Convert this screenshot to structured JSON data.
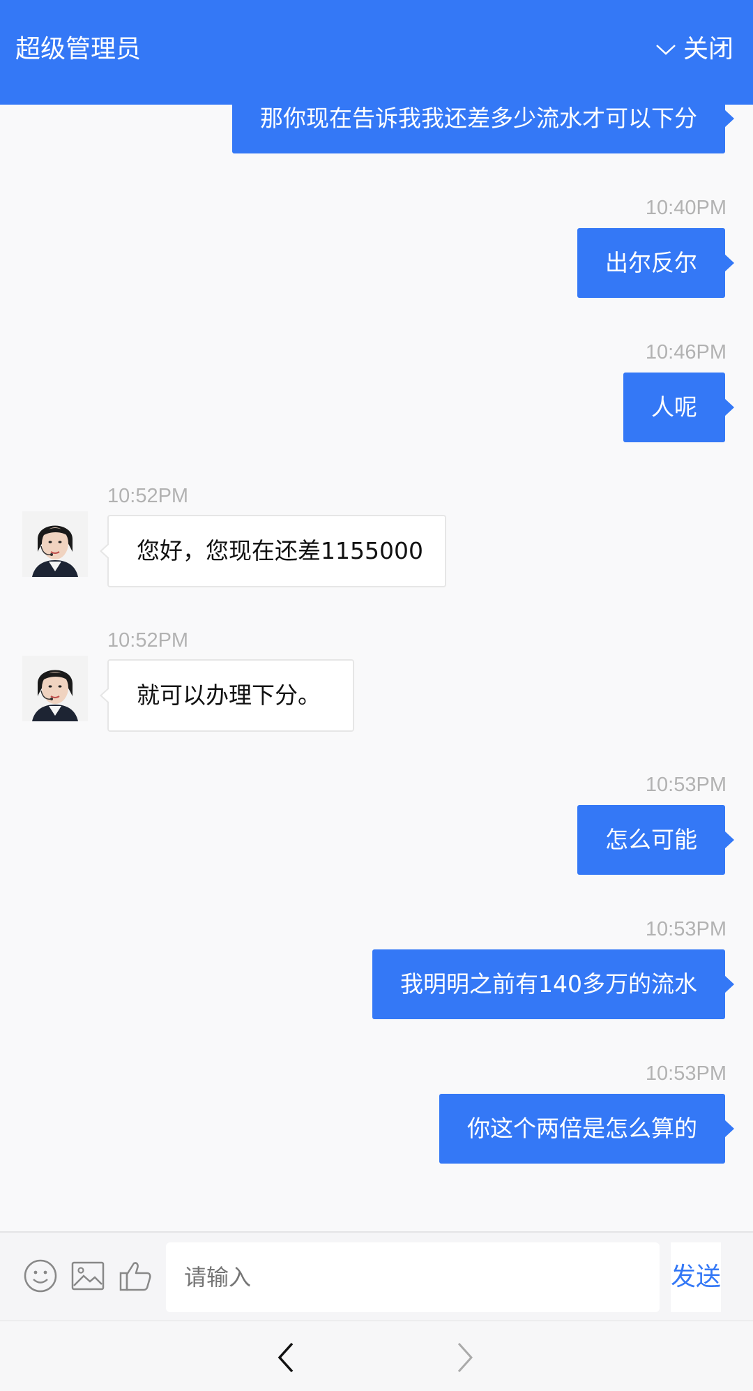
{
  "header": {
    "title": "超级管理员",
    "close_label": "关闭",
    "background": "#3478f6"
  },
  "messages": [
    {
      "direction": "out",
      "time": "",
      "text": "那你现在告诉我我还差多少流水才可以下分"
    },
    {
      "direction": "out",
      "time": "10:40PM",
      "text": "出尔反尔"
    },
    {
      "direction": "out",
      "time": "10:46PM",
      "text": "人呢"
    },
    {
      "direction": "in",
      "time": "10:52PM",
      "text": "您好，您现在还差1155000"
    },
    {
      "direction": "in",
      "time": "10:52PM",
      "text": "就可以办理下分。"
    },
    {
      "direction": "out",
      "time": "10:53PM",
      "text": "怎么可能"
    },
    {
      "direction": "out",
      "time": "10:53PM",
      "text": "我明明之前有140多万的流水"
    },
    {
      "direction": "out",
      "time": "10:53PM",
      "text": "你这个两倍是怎么算的"
    }
  ],
  "input": {
    "placeholder": "请输入",
    "send_label": "发送",
    "icons": [
      "emoji-icon",
      "image-icon",
      "thumbs-up-icon"
    ]
  },
  "navigation": {
    "icons": [
      "back-icon",
      "forward-icon"
    ]
  },
  "colors": {
    "accent": "#3478f6",
    "timestamp": "#b2b2b2"
  }
}
